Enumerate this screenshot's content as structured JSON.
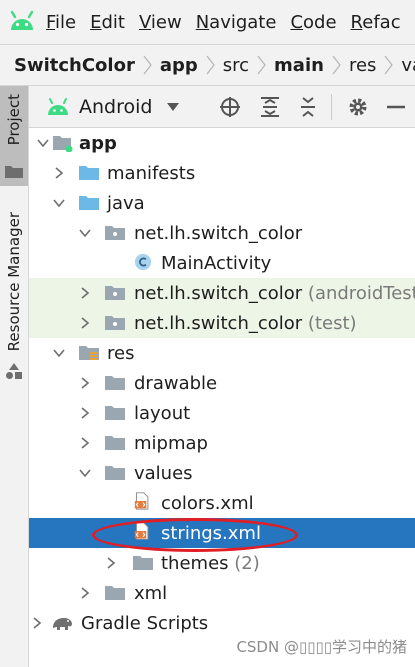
{
  "menubar": {
    "items": [
      {
        "mnemonic": "F",
        "rest": "ile"
      },
      {
        "mnemonic": "E",
        "rest": "dit"
      },
      {
        "mnemonic": "V",
        "rest": "iew"
      },
      {
        "mnemonic": "N",
        "rest": "avigate"
      },
      {
        "mnemonic": "C",
        "rest": "ode"
      },
      {
        "mnemonic": "R",
        "rest": "efac"
      }
    ]
  },
  "breadcrumb": [
    "SwitchColor",
    "app",
    "src",
    "main",
    "res",
    "value"
  ],
  "strip": {
    "project_tab": "Project",
    "resource_manager_tab": "Resource Manager"
  },
  "project_toolbar": {
    "view": "Android"
  },
  "tree": [
    {
      "label": "app",
      "suffix": ""
    },
    {
      "label": "manifests",
      "suffix": ""
    },
    {
      "label": "java",
      "suffix": ""
    },
    {
      "label": "net.lh.switch_color",
      "suffix": ""
    },
    {
      "label": "MainActivity",
      "suffix": ""
    },
    {
      "label": "net.lh.switch_color",
      "suffix": "(androidTest)"
    },
    {
      "label": "net.lh.switch_color",
      "suffix": "(test)"
    },
    {
      "label": "res",
      "suffix": ""
    },
    {
      "label": "drawable",
      "suffix": ""
    },
    {
      "label": "layout",
      "suffix": ""
    },
    {
      "label": "mipmap",
      "suffix": ""
    },
    {
      "label": "values",
      "suffix": ""
    },
    {
      "label": "colors.xml",
      "suffix": ""
    },
    {
      "label": "strings.xml",
      "suffix": ""
    },
    {
      "label": "themes",
      "suffix": "(2)"
    },
    {
      "label": "xml",
      "suffix": ""
    },
    {
      "label": "Gradle Scripts",
      "suffix": ""
    }
  ],
  "watermark": "CSDN @▯▯▯▯学习中的猪",
  "colors": {
    "selection": "#2675bf",
    "test_highlight": "#edf5e7",
    "annotation": "#e01e24",
    "android_green": "#3ddc84",
    "folder_blue": "#6cb8e6"
  }
}
